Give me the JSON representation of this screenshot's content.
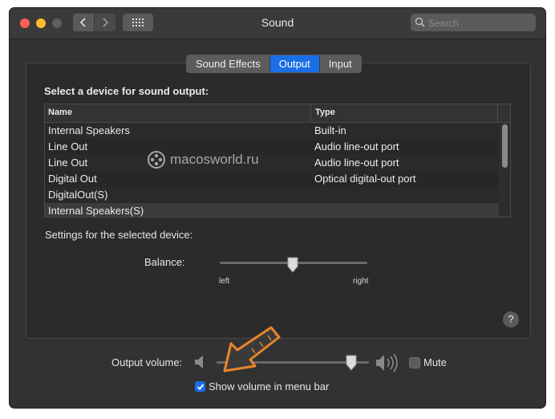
{
  "window": {
    "title": "Sound",
    "search_placeholder": "Search"
  },
  "tabs": [
    {
      "label": "Sound Effects",
      "active": false
    },
    {
      "label": "Output",
      "active": true
    },
    {
      "label": "Input",
      "active": false
    }
  ],
  "output": {
    "select_label": "Select a device for sound output:",
    "columns": [
      "Name",
      "Type"
    ],
    "devices": [
      {
        "name": "Internal Speakers",
        "type": "Built-in"
      },
      {
        "name": "Line Out",
        "type": "Audio line-out port"
      },
      {
        "name": "Line Out",
        "type": "Audio line-out port"
      },
      {
        "name": "Digital Out",
        "type": "Optical digital-out port"
      },
      {
        "name": "DigitalOut(S)",
        "type": ""
      },
      {
        "name": "Internal Speakers(S)",
        "type": "",
        "selected": true
      }
    ],
    "settings_label": "Settings for the selected device:",
    "balance": {
      "label": "Balance:",
      "left_label": "left",
      "right_label": "right",
      "value": 0.5
    }
  },
  "watermark": "macosworld.ru",
  "bottom": {
    "output_volume_label": "Output volume:",
    "volume_level": 0.88,
    "mute_label": "Mute",
    "mute_checked": false,
    "show_volume_label": "Show volume in menu bar",
    "show_volume_checked": true
  },
  "help_label": "?",
  "colors": {
    "window_bg": "#323232",
    "accent": "#1a6ee6",
    "annotation_arrow": "#e8862b"
  }
}
